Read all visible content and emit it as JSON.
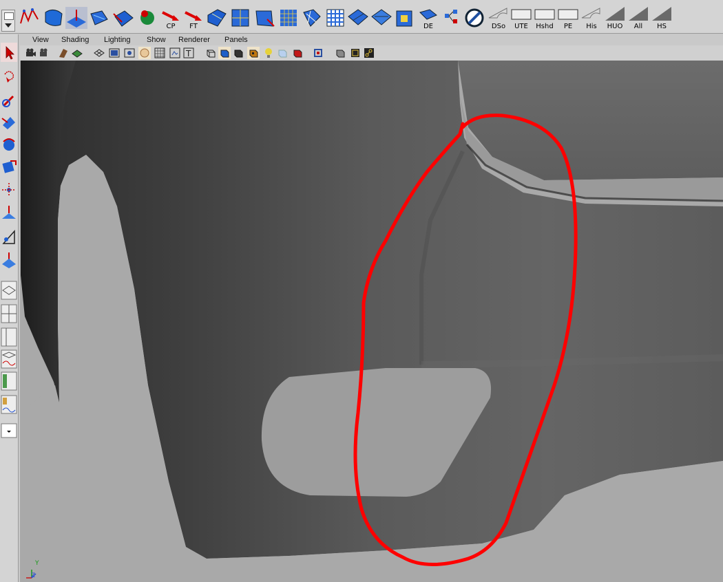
{
  "shelf": {
    "buttons": [
      {
        "name": "curve-tool-icon",
        "label": ""
      },
      {
        "name": "revolve-surface-icon",
        "label": ""
      },
      {
        "name": "surface-normal-icon",
        "label": ""
      },
      {
        "name": "loft-surface-icon",
        "label": ""
      },
      {
        "name": "birail-surface-icon",
        "label": ""
      },
      {
        "name": "sphere-tool-icon",
        "label": ""
      },
      {
        "name": "control-points-icon",
        "label": "CP"
      },
      {
        "name": "freeform-tool-icon",
        "label": "FT"
      },
      {
        "name": "blue-surface-icon",
        "label": ""
      },
      {
        "name": "split-surface-icon",
        "label": ""
      },
      {
        "name": "trim-surface-icon",
        "label": ""
      },
      {
        "name": "grid-surface-icon",
        "label": ""
      },
      {
        "name": "multi-surface-icon",
        "label": ""
      },
      {
        "name": "patch-grid-icon",
        "label": ""
      },
      {
        "name": "stitch-surface-icon",
        "label": ""
      },
      {
        "name": "attach-surface-icon",
        "label": ""
      },
      {
        "name": "center-pivot-icon",
        "label": ""
      },
      {
        "name": "delete-edge-icon",
        "label": "DE"
      },
      {
        "name": "connected-nodes-icon",
        "label": ""
      },
      {
        "name": "circle-slash-icon",
        "label": ""
      },
      {
        "name": "display-smooth-icon",
        "label": "DSo"
      },
      {
        "name": "unlock-texture-icon",
        "label": "UTE"
      },
      {
        "name": "hide-shaded-icon",
        "label": "Hshd"
      },
      {
        "name": "perspective-icon",
        "label": "PE"
      },
      {
        "name": "history-icon",
        "label": "His"
      },
      {
        "name": "hide-unselected-icon",
        "label": "HUO"
      },
      {
        "name": "show-all-icon",
        "label": "All"
      },
      {
        "name": "hide-selected-icon",
        "label": "HS"
      }
    ]
  },
  "panel": {
    "menus": [
      "View",
      "Shading",
      "Lighting",
      "Show",
      "Renderer",
      "Panels"
    ]
  },
  "viewport": {
    "axis_y": "Y",
    "axis_z": "Z"
  },
  "colors": {
    "annotation": "#ff0000",
    "shelf_bg": "#d4d4d4",
    "viewport_bg": "#a9a9a9"
  }
}
